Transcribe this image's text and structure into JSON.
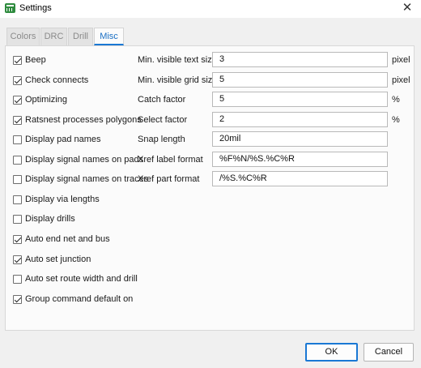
{
  "window": {
    "title": "Settings",
    "close_glyph": "✕"
  },
  "tabs": [
    {
      "label": "Colors",
      "active": false
    },
    {
      "label": "DRC",
      "active": false
    },
    {
      "label": "Drill",
      "active": false
    },
    {
      "label": "Misc",
      "active": true
    }
  ],
  "checkboxes": [
    {
      "label": "Beep",
      "checked": true
    },
    {
      "label": "Check connects",
      "checked": true
    },
    {
      "label": "Optimizing",
      "checked": true
    },
    {
      "label": "Ratsnest processes polygons",
      "checked": true
    },
    {
      "label": "Display pad names",
      "checked": false
    },
    {
      "label": "Display signal names on pads",
      "checked": false
    },
    {
      "label": "Display signal names on traces",
      "checked": false
    },
    {
      "label": "Display via lengths",
      "checked": false
    },
    {
      "label": "Display drills",
      "checked": false
    },
    {
      "label": "Auto end net and bus",
      "checked": true
    },
    {
      "label": "Auto set junction",
      "checked": true
    },
    {
      "label": "Auto set route width and drill",
      "checked": false
    },
    {
      "label": "Group command default on",
      "checked": true
    }
  ],
  "fields": [
    {
      "label": "Min. visible text size",
      "value": "3",
      "unit": "pixel"
    },
    {
      "label": "Min. visible grid size",
      "value": "5",
      "unit": "pixel"
    },
    {
      "label": "Catch factor",
      "value": "5",
      "unit": "%"
    },
    {
      "label": "Select factor",
      "value": "2",
      "unit": "%"
    },
    {
      "label": "Snap length",
      "value": "20mil",
      "unit": ""
    },
    {
      "label": "Xref label format",
      "value": "%F%N/%S.%C%R",
      "unit": ""
    },
    {
      "label": "Xref part format",
      "value": "/%S.%C%R",
      "unit": ""
    }
  ],
  "buttons": {
    "ok": "OK",
    "cancel": "Cancel"
  },
  "icons": {
    "app": "eagle-app-icon",
    "close": "close-icon"
  },
  "colors": {
    "accent": "#1a78d4",
    "tab_active_text": "#1a6fc4",
    "app_icon": "#2e8b3e"
  }
}
